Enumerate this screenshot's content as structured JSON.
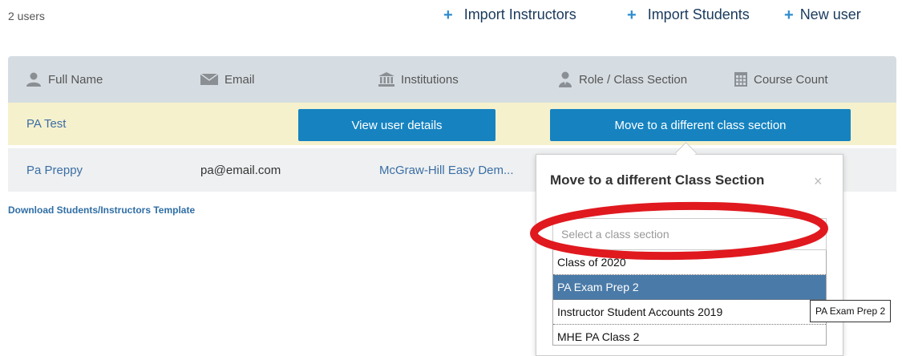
{
  "header": {
    "user_count": "2 users",
    "actions": {
      "import_instructors": "Import Instructors",
      "import_students": "Import Students",
      "new_user": "New user"
    }
  },
  "table": {
    "columns": [
      {
        "label": "Full Name",
        "icon": "person-icon"
      },
      {
        "label": "Email",
        "icon": "envelope-icon"
      },
      {
        "label": "Institutions",
        "icon": "institution-icon"
      },
      {
        "label": "Role / Class Section",
        "icon": "role-icon"
      },
      {
        "label": "Course Count",
        "icon": "grid-icon"
      }
    ],
    "rows": [
      {
        "name": "PA Test",
        "view_details_label": "View user details",
        "move_section_label": "Move to a different class section"
      },
      {
        "name": "Pa Preppy",
        "email": "pa@email.com",
        "institution": "McGraw-Hill Easy Dem..."
      }
    ]
  },
  "download_template": "Download Students/Instructors Template",
  "popover": {
    "title": "Move to a different Class Section",
    "close": "×",
    "select": {
      "placeholder": "Select a class section",
      "options": [
        "Class of 2020",
        "PA Exam Prep 2",
        "Instructor Student Accounts 2019",
        "MHE PA Class 2"
      ],
      "highlighted": "PA Exam Prep 2"
    },
    "tooltip": "PA Exam Prep 2"
  },
  "colors": {
    "accent": "#1683c0",
    "highlight_row": "#f6f1cd",
    "annotation": "#e0191f"
  }
}
